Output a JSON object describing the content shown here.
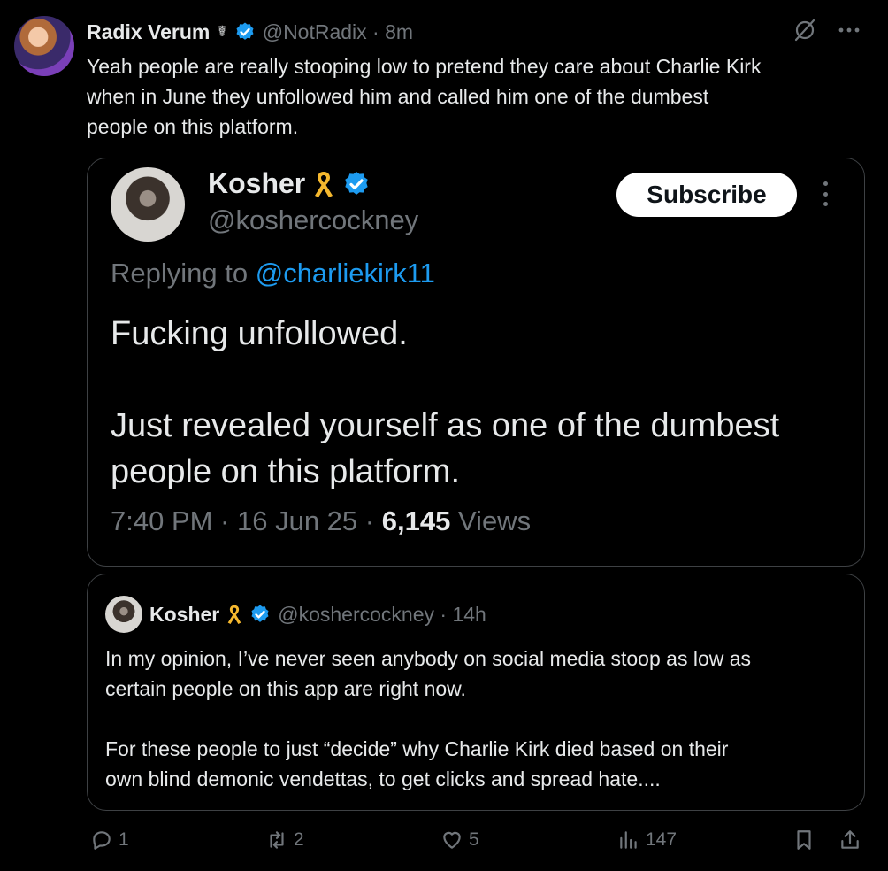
{
  "post": {
    "author_name": "Radix Verum",
    "author_symbol": "☤",
    "handle_time": "@NotRadix · 8m",
    "text": "Yeah people are really stooping low to pretend they care about Charlie Kirk\nwhen in June they unfollowed him and called him one of the dumbest\npeople on this platform."
  },
  "quote_card": {
    "name": "Kosher",
    "handle": "@koshercockney",
    "subscribe_label": "Subscribe",
    "replying_prefix": "Replying to",
    "replying_mention": "@charliekirk11",
    "body": "Fucking unfollowed.\n\nJust revealed yourself as one of the dumbest\npeople on this platform.",
    "timestamp": "7:40 PM · 16 Jun 25 ·",
    "views_count": "6,145",
    "views_label": "Views"
  },
  "embedded_post": {
    "name": "Kosher",
    "handle_time": "@koshercockney · 14h",
    "text": "In my opinion, I’ve never seen anybody on social media stoop as low as\ncertain people on this app are right now.\n\nFor these people to just “decide” why Charlie Kirk died based on their\nown blind demonic vendettas, to get clicks and spread hate...."
  },
  "actions": {
    "replies": "1",
    "reposts": "2",
    "likes": "5",
    "views": "147"
  },
  "colors": {
    "accent": "#1d9bf0",
    "muted": "#71767b",
    "ribbon": "#f5b82e"
  }
}
